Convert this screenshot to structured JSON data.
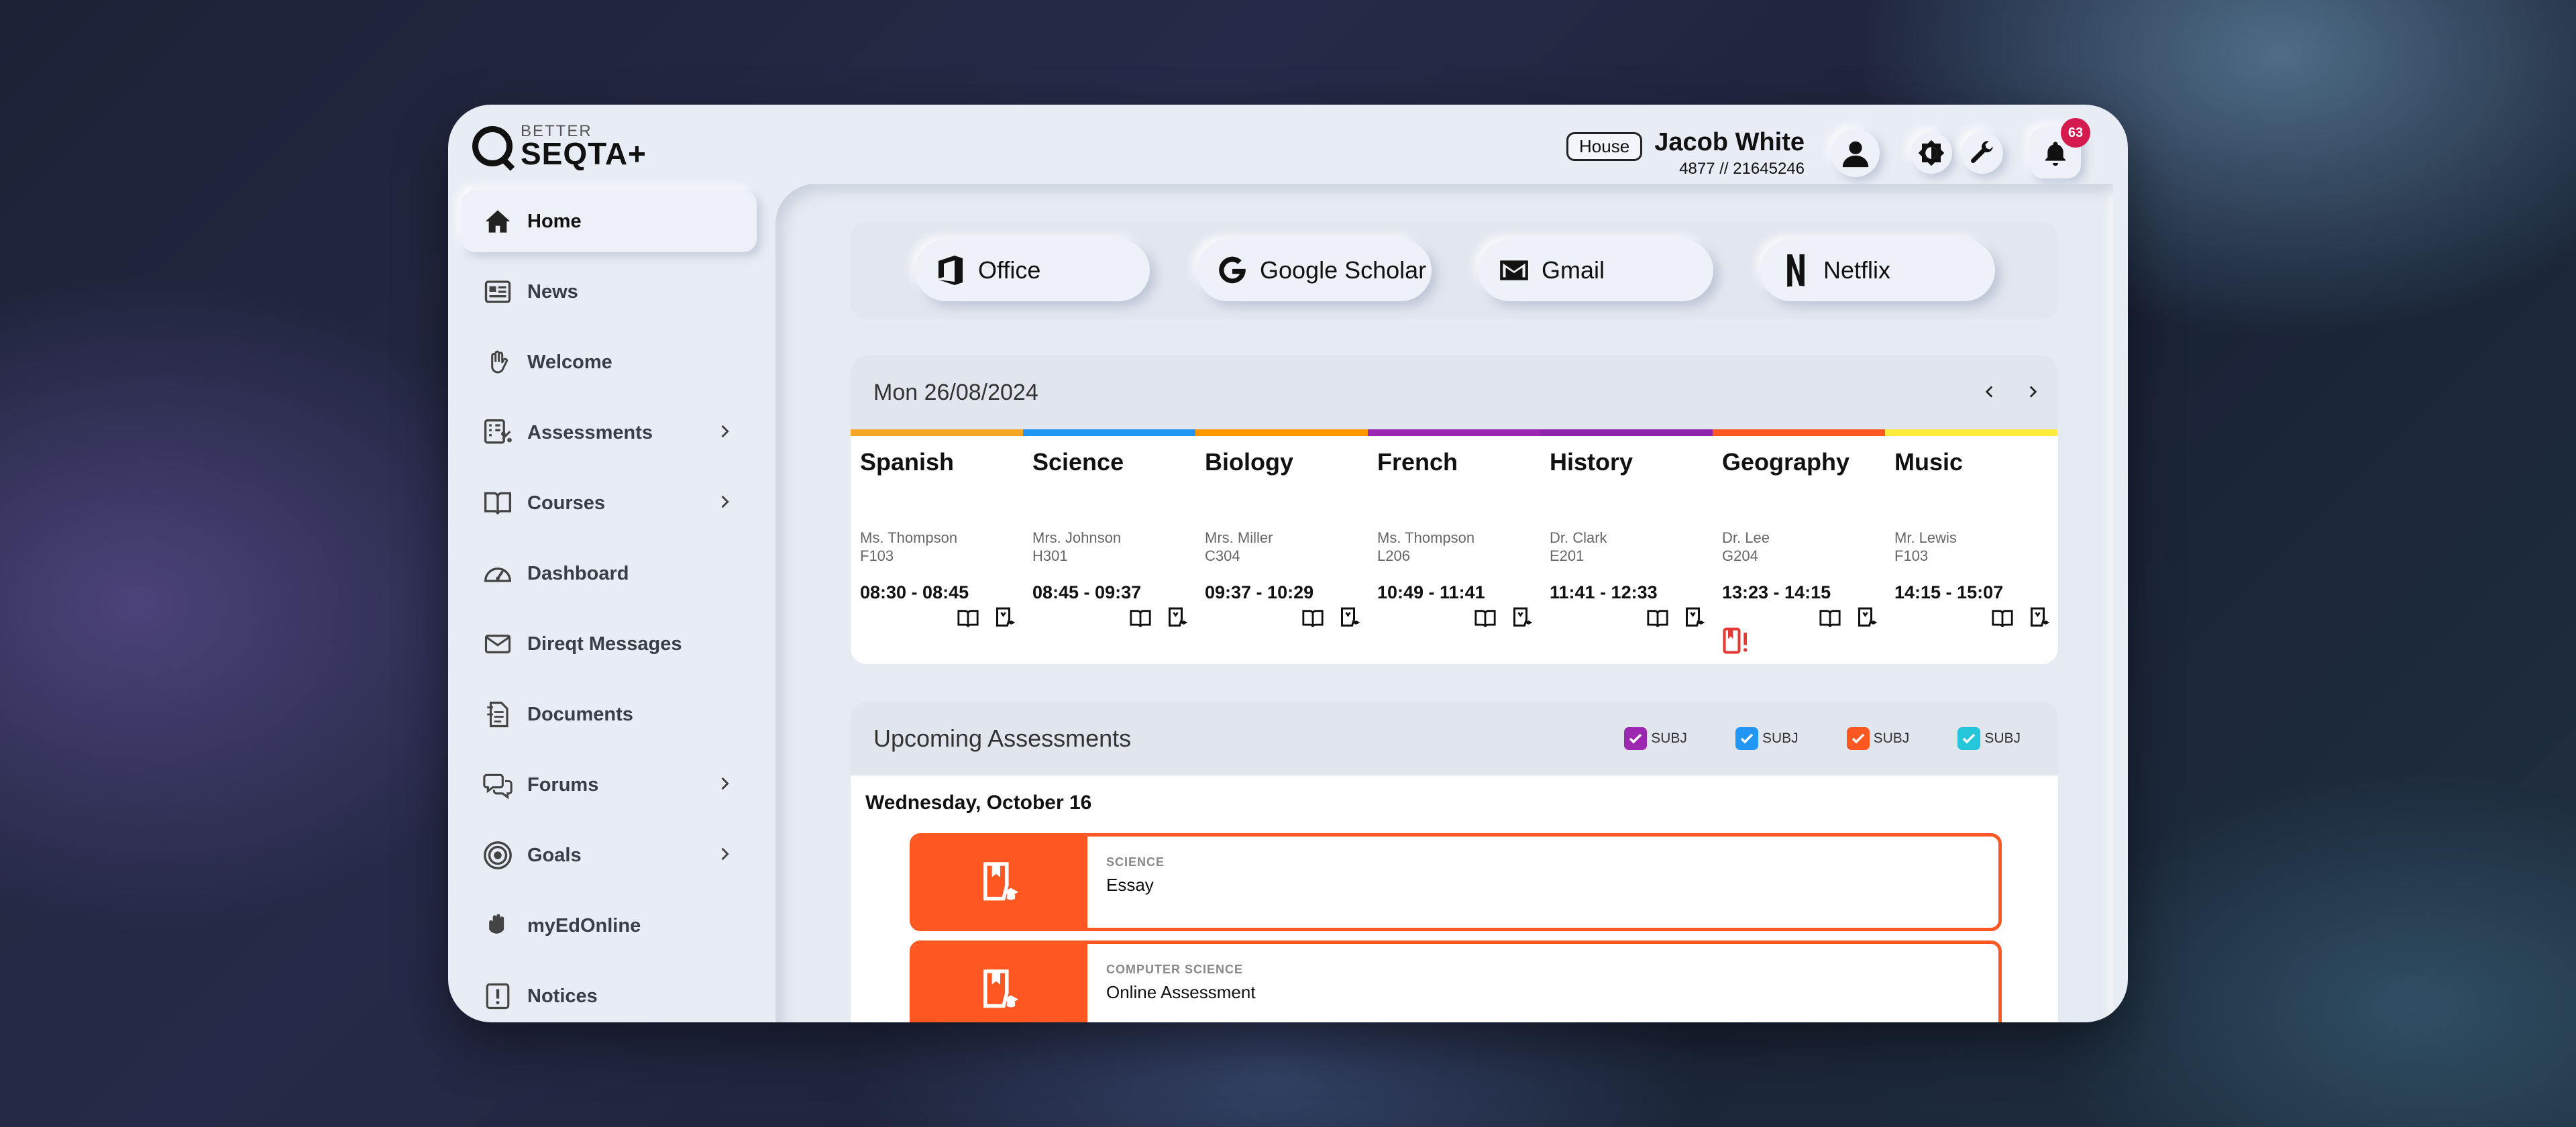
{
  "brand": {
    "small": "BETTER",
    "large": "SEQTA+"
  },
  "user": {
    "house": "House",
    "name": "Jacob White",
    "id_line": "4877 // 21645246",
    "notifications": "63"
  },
  "sidebar": {
    "items": [
      {
        "label": "Home",
        "icon": "home-icon"
      },
      {
        "label": "News",
        "icon": "news-icon"
      },
      {
        "label": "Welcome",
        "icon": "wave-hand-icon"
      },
      {
        "label": "Assessments",
        "icon": "assessments-icon"
      },
      {
        "label": "Courses",
        "icon": "book-open-icon"
      },
      {
        "label": "Dashboard",
        "icon": "gauge-icon"
      },
      {
        "label": "Direqt Messages",
        "icon": "mail-icon"
      },
      {
        "label": "Documents",
        "icon": "document-icon"
      },
      {
        "label": "Forums",
        "icon": "chat-bubbles-icon"
      },
      {
        "label": "Goals",
        "icon": "target-icon"
      },
      {
        "label": "myEdOnline",
        "icon": "hand-icon"
      },
      {
        "label": "Notices",
        "icon": "notice-icon"
      }
    ]
  },
  "shortcuts": [
    {
      "label": "Office",
      "icon": "office-icon"
    },
    {
      "label": "Google Scholar",
      "icon": "google-icon"
    },
    {
      "label": "Gmail",
      "icon": "gmail-icon"
    },
    {
      "label": "Netflix",
      "icon": "netflix-icon"
    }
  ],
  "timetable": {
    "date": "Mon 26/08/2024",
    "lessons": [
      {
        "subject": "Spanish",
        "teacher": "Ms. Thompson",
        "room": "F103",
        "time": "08:30 - 08:45",
        "color": "#f5a623"
      },
      {
        "subject": "Science",
        "teacher": "Mrs. Johnson",
        "room": "H301",
        "time": "08:45 - 09:37",
        "color": "#2196f3"
      },
      {
        "subject": "Biology",
        "teacher": "Mrs. Miller",
        "room": "C304",
        "time": "09:37 - 10:29",
        "color": "#ff9800"
      },
      {
        "subject": "French",
        "teacher": "Ms. Thompson",
        "room": "L206",
        "time": "10:49 - 11:41",
        "color": "#9c27b0"
      },
      {
        "subject": "History",
        "teacher": "Dr. Clark",
        "room": "E201",
        "time": "11:41 - 12:33",
        "color": "#8e24aa"
      },
      {
        "subject": "Geography",
        "teacher": "Dr. Lee",
        "room": "G204",
        "time": "13:23 - 14:15",
        "color": "#ff5722"
      },
      {
        "subject": "Music",
        "teacher": "Mr. Lewis",
        "room": "F103",
        "time": "14:15 - 15:07",
        "color": "#ffeb3b"
      }
    ]
  },
  "assessments": {
    "title": "Upcoming Assessments",
    "filters": [
      {
        "label": "SUBJ",
        "color": "#9c27b0"
      },
      {
        "label": "SUBJ",
        "color": "#2196f3"
      },
      {
        "label": "SUBJ",
        "color": "#ff5722"
      },
      {
        "label": "SUBJ",
        "color": "#26c6da"
      }
    ],
    "day": "Wednesday, October 16",
    "items": [
      {
        "subject": "SCIENCE",
        "title": "Essay",
        "color": "#ff5722"
      },
      {
        "subject": "COMPUTER SCIENCE",
        "title": "Online Assessment",
        "color": "#ff5722"
      }
    ]
  }
}
